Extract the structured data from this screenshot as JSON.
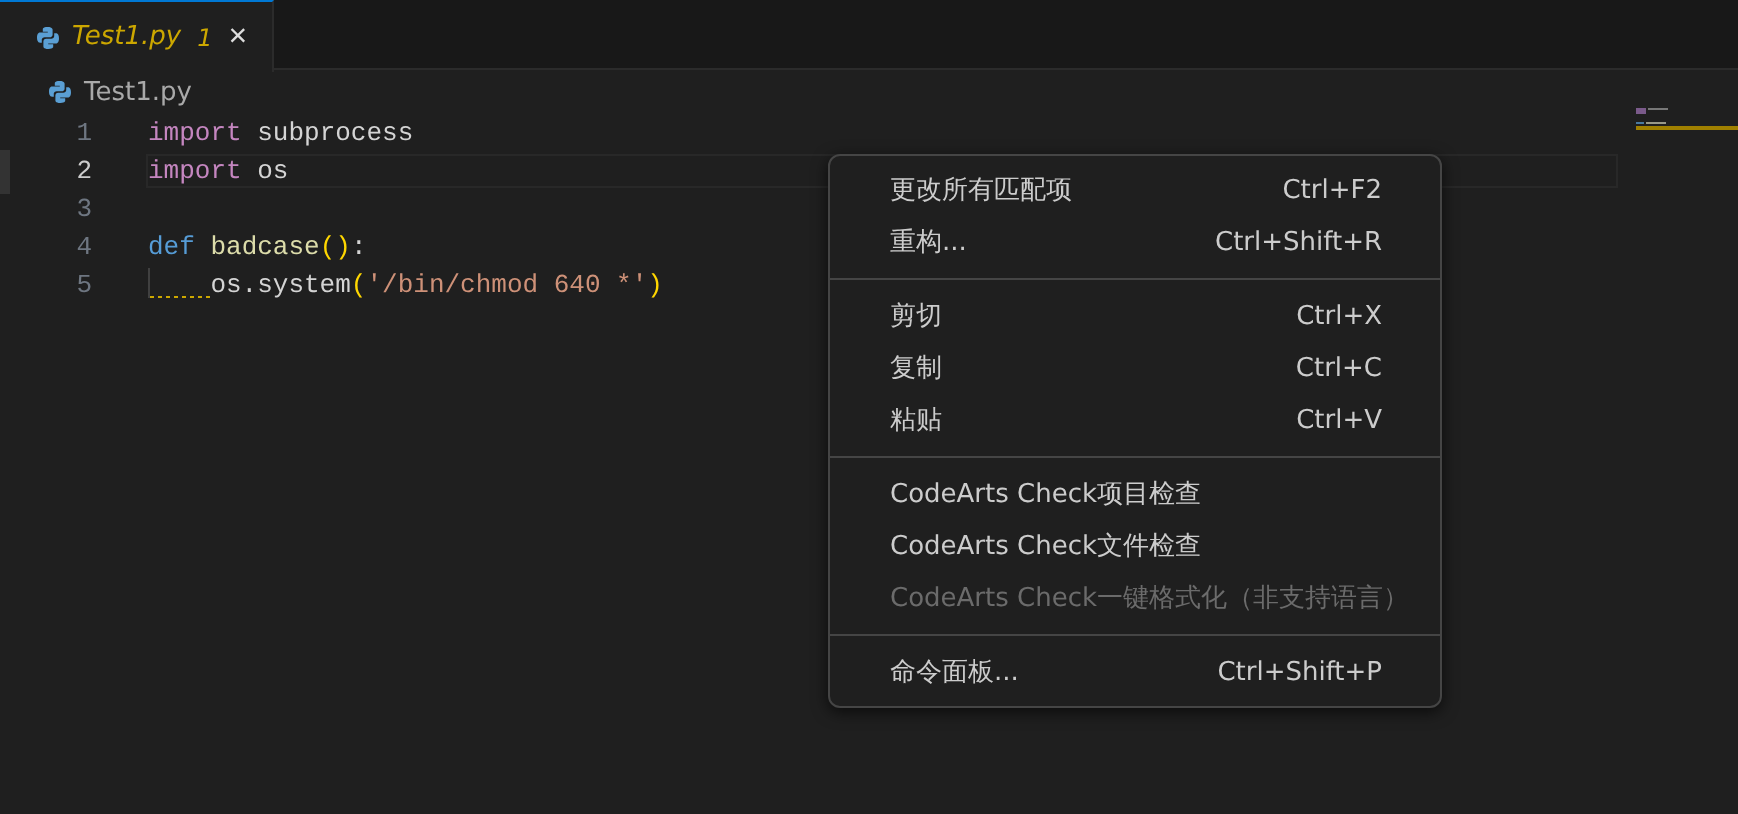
{
  "tab": {
    "title": "Test1.py",
    "problems": "1",
    "selected": true,
    "close": "×"
  },
  "breadcrumb": {
    "file": "Test1.py"
  },
  "code": [
    {
      "number": "1",
      "current": false,
      "tokens": [
        {
          "kind": "keyword",
          "text": "import"
        },
        {
          "kind": "plain",
          "text": " subprocess"
        }
      ]
    },
    {
      "number": "2",
      "current": true,
      "tokens": [
        {
          "kind": "keyword",
          "text": "import"
        },
        {
          "kind": "plain",
          "text": " os"
        }
      ]
    },
    {
      "number": "3",
      "current": false
    },
    {
      "number": "4",
      "current": false,
      "tokens": [
        {
          "kind": "storage",
          "text": "def "
        },
        {
          "kind": "function",
          "text": "badcase"
        },
        {
          "kind": "paren",
          "text": "()"
        },
        {
          "kind": "plain",
          "text": ":"
        }
      ]
    },
    {
      "number": "5",
      "current": false,
      "squiggle": true,
      "tokens": [
        {
          "kind": "plain",
          "text": "os.system"
        },
        {
          "kind": "paren",
          "text": "("
        },
        {
          "kind": "string",
          "text": "'/bin/chmod 640 *'"
        },
        {
          "kind": "paren",
          "text": ")"
        }
      ]
    }
  ],
  "context_menu": [
    [
      {
        "label": "更改所有匹配项",
        "shortcut": "Ctrl+F2",
        "disabled": false
      },
      {
        "label": "重构...",
        "shortcut": "Ctrl+Shift+R",
        "disabled": false
      }
    ],
    [
      {
        "label": "剪切",
        "shortcut": "Ctrl+X",
        "disabled": false
      },
      {
        "label": "复制",
        "shortcut": "Ctrl+C",
        "disabled": false
      },
      {
        "label": "粘贴",
        "shortcut": "Ctrl+V",
        "disabled": false
      }
    ],
    [
      {
        "label": "CodeArts Check项目检查",
        "disabled": false
      },
      {
        "label": "CodeArts Check文件检查",
        "disabled": false
      },
      {
        "label": "CodeArts Check一键格式化（非支持语言）",
        "disabled": true
      }
    ],
    [
      {
        "label": "命令面板...",
        "shortcut": "Ctrl+Shift+P",
        "disabled": false
      }
    ]
  ]
}
